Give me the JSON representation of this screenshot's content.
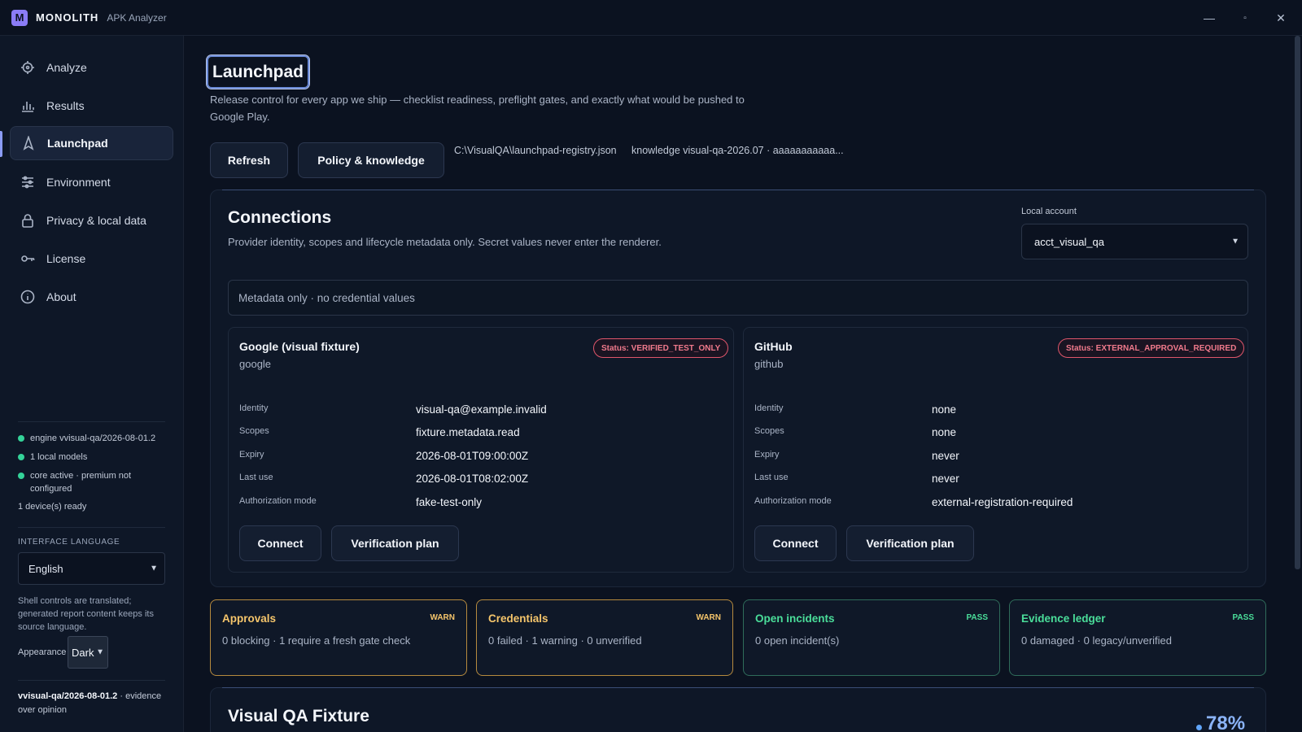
{
  "app": {
    "logo_letter": "M",
    "name": "MONOLITH",
    "subtitle": "APK Analyzer",
    "accent": "#8b7cf6"
  },
  "window_controls": {
    "minimize": "—",
    "maximize": "▫",
    "close": "✕"
  },
  "sidebar": {
    "items": [
      {
        "label": "Analyze",
        "icon": "target-icon"
      },
      {
        "label": "Results",
        "icon": "bar-chart-icon"
      },
      {
        "label": "Launchpad",
        "icon": "rocket-icon",
        "active": true
      },
      {
        "label": "Environment",
        "icon": "sliders-icon"
      },
      {
        "label": "Privacy & local data",
        "icon": "lock-icon"
      },
      {
        "label": "License",
        "icon": "key-icon"
      },
      {
        "label": "About",
        "icon": "info-icon"
      }
    ],
    "status": {
      "engine": "engine vvisual-qa/2026-08-01.2",
      "models": "1 local models",
      "core": "core active · premium not configured",
      "devices": "1 device(s) ready"
    },
    "language_label": "INTERFACE LANGUAGE",
    "language_value": "English",
    "language_note": "Shell controls are translated; generated report content keeps its source language.",
    "appearance_label": "Appearance",
    "appearance_value": "Dark",
    "build_version": "vvisual-qa/2026-08-01.2",
    "build_tagline": "evidence over opinion"
  },
  "page": {
    "title": "Launchpad",
    "description": "Release control for every app we ship — checklist readiness, preflight gates, and exactly what would be pushed to Google Play.",
    "refresh_label": "Refresh",
    "policy_label": "Policy & knowledge",
    "registry_path": "C:\\VisualQA\\launchpad-registry.json",
    "knowledge_info": "knowledge visual-qa-2026.07 · aaaaaaaaaaa..."
  },
  "connections": {
    "title": "Connections",
    "description": "Provider identity, scopes and lifecycle metadata only. Secret values never enter the renderer.",
    "account_label": "Local account",
    "account_value": "acct_visual_qa",
    "metadata_note": "Metadata only · no credential values",
    "providers": [
      {
        "name": "Google (visual fixture)",
        "id": "google",
        "status": "Status: VERIFIED_TEST_ONLY",
        "fields": [
          {
            "key": "Identity",
            "value": "visual-qa@example.invalid"
          },
          {
            "key": "Scopes",
            "value": "fixture.metadata.read"
          },
          {
            "key": "Expiry",
            "value": "2026-08-01T09:00:00Z"
          },
          {
            "key": "Last use",
            "value": "2026-08-01T08:02:00Z"
          },
          {
            "key": "Authorization mode",
            "value": "fake-test-only"
          }
        ],
        "connect_label": "Connect",
        "verify_label": "Verification plan"
      },
      {
        "name": "GitHub",
        "id": "github",
        "status": "Status: EXTERNAL_APPROVAL_REQUIRED",
        "fields": [
          {
            "key": "Identity",
            "value": "none"
          },
          {
            "key": "Scopes",
            "value": "none"
          },
          {
            "key": "Expiry",
            "value": "never"
          },
          {
            "key": "Last use",
            "value": "never"
          },
          {
            "key": "Authorization mode",
            "value": "external-registration-required"
          }
        ],
        "connect_label": "Connect",
        "verify_label": "Verification plan"
      }
    ]
  },
  "gates": [
    {
      "title": "Approvals",
      "status": "WARN",
      "desc": "0 blocking · 1 require a fresh gate check"
    },
    {
      "title": "Credentials",
      "status": "WARN",
      "desc": "0 failed · 1 warning · 0 unverified"
    },
    {
      "title": "Open incidents",
      "status": "PASS",
      "desc": "0 open incident(s)"
    },
    {
      "title": "Evidence ledger",
      "status": "PASS",
      "desc": "0 damaged · 0 legacy/unverified"
    }
  ],
  "fixture": {
    "title": "Visual QA Fixture",
    "readiness": "78%"
  },
  "colors": {
    "warn": "#f5c56b",
    "pass": "#4ade9a",
    "danger": "#f07a8c",
    "status_ok": "#34d399"
  }
}
